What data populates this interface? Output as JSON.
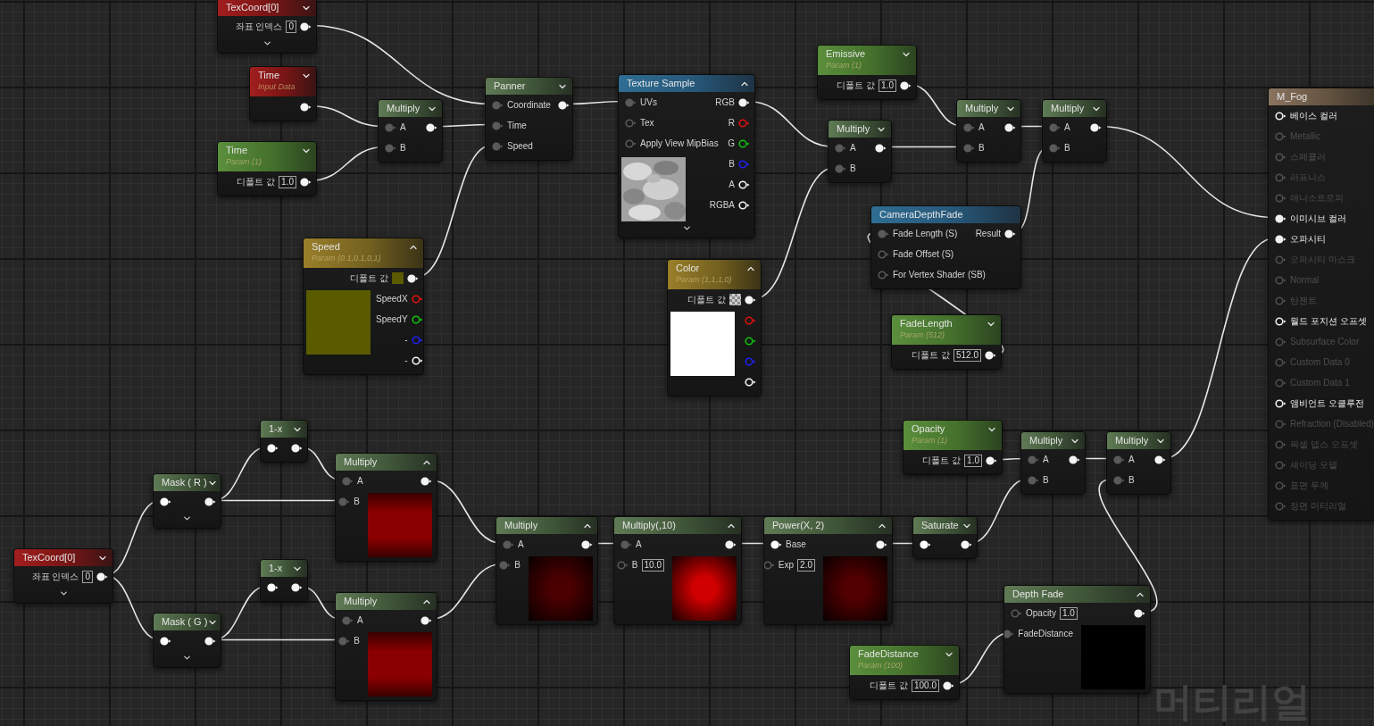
{
  "nodes": [
    {
      "title": "TexCoord[0]",
      "kind": "input",
      "expanded": false,
      "expander": true,
      "rows": [
        {
          "label": "좌표 인덱스",
          "value": "0",
          "out": {
            "connected": true
          }
        }
      ]
    },
    {
      "title": "Time",
      "subtitle": "Input Data",
      "kind": "input",
      "expanded": false,
      "rows": [
        {
          "out": {
            "connected": true
          }
        }
      ]
    },
    {
      "title": "Time",
      "subtitle": "Param (1)",
      "kind": "param",
      "expanded": false,
      "rows": [
        {
          "label": "디폴트 값",
          "value": "1.0",
          "out": {
            "connected": true
          }
        }
      ]
    },
    {
      "title": "Multiply",
      "kind": "math",
      "expanded": false,
      "rows": [
        {
          "in": {
            "connected": true
          },
          "label": "A",
          "out": {
            "connected": true
          }
        },
        {
          "in": {
            "connected": true
          },
          "label": "B"
        }
      ]
    },
    {
      "title": "Panner",
      "kind": "math",
      "expanded": false,
      "rows": [
        {
          "in": {
            "connected": true
          },
          "label": "Coordinate",
          "out": {
            "connected": true
          }
        },
        {
          "in": {
            "connected": true
          },
          "label": "Time"
        },
        {
          "in": {
            "connected": true
          },
          "label": "Speed"
        }
      ]
    },
    {
      "title": "Texture Sample",
      "kind": "texture",
      "expanded": true,
      "expander": true,
      "rows": [
        {
          "in": {
            "connected": true
          },
          "label": "UVs",
          "out_label": "RGB",
          "out": {
            "connected": true
          }
        },
        {
          "in": {
            "connected": false
          },
          "label": "Tex",
          "out_label": "R",
          "out": {
            "connected": false,
            "color": "#e01010"
          }
        },
        {
          "in": {
            "connected": false
          },
          "label": "Apply View MipBias",
          "out_label": "G",
          "out": {
            "connected": false,
            "color": "#10c010"
          }
        }
      ],
      "preview": {
        "kind": "texture"
      },
      "side_rows": [
        {
          "out_label": "B",
          "out": {
            "connected": false,
            "color": "#2020f0"
          }
        },
        {
          "out_label": "A",
          "out": {
            "connected": false
          }
        },
        {
          "out_label": "RGBA",
          "out": {
            "connected": false
          }
        }
      ]
    },
    {
      "title": "Emissive",
      "subtitle": "Param (1)",
      "kind": "param",
      "expanded": false,
      "rows": [
        {
          "label": "디폴트 값",
          "value": "1.0",
          "out": {
            "connected": true
          }
        }
      ]
    },
    {
      "title": "Multiply",
      "kind": "math",
      "expanded": false,
      "rows": [
        {
          "in": {
            "connected": true
          },
          "label": "A",
          "out": {
            "connected": true
          }
        },
        {
          "in": {
            "connected": true
          },
          "label": "B"
        }
      ]
    },
    {
      "title": "Multiply",
      "kind": "math",
      "expanded": false,
      "rows": [
        {
          "in": {
            "connected": true
          },
          "label": "A",
          "out": {
            "connected": true
          }
        },
        {
          "in": {
            "connected": true
          },
          "label": "B"
        }
      ]
    },
    {
      "title": "Multiply",
      "kind": "math",
      "expanded": false,
      "rows": [
        {
          "in": {
            "connected": true
          },
          "label": "A",
          "out": {
            "connected": true
          }
        },
        {
          "in": {
            "connected": true
          },
          "label": "B"
        }
      ]
    },
    {
      "title": "Speed",
      "subtitle": "Param (0.1,0.1,0,1)",
      "kind": "vector",
      "expanded": true,
      "rows": [
        {
          "label": "디폴트 값",
          "swatch": {
            "kind": "solid",
            "color": "#5a5a00"
          },
          "out": {
            "connected": true
          }
        }
      ],
      "preview": {
        "kind": "solid",
        "color": "#5a5a00"
      },
      "side_rows": [
        {
          "out_label": "SpeedX",
          "out": {
            "connected": false,
            "color": "#e01010"
          }
        },
        {
          "out_label": "SpeedY",
          "out": {
            "connected": false,
            "color": "#10c010"
          }
        },
        {
          "out_label": "-",
          "out": {
            "connected": false,
            "color": "#2020f0"
          }
        },
        {
          "out_label": "-",
          "out": {
            "connected": false
          }
        }
      ]
    },
    {
      "title": "Color",
      "subtitle": "Param (1,1,1,0)",
      "kind": "vector",
      "expanded": true,
      "rows": [
        {
          "label": "디폴트 값",
          "swatch": {
            "kind": "checker"
          },
          "out": {
            "connected": true
          }
        }
      ],
      "preview": {
        "kind": "solid",
        "color": "#ffffff"
      },
      "side_rows": [
        {
          "out": {
            "connected": false,
            "color": "#e01010"
          }
        },
        {
          "out": {
            "connected": false,
            "color": "#10c010"
          }
        },
        {
          "out": {
            "connected": false,
            "color": "#2020f0"
          }
        },
        {
          "out": {
            "connected": false
          }
        }
      ]
    },
    {
      "title": "CameraDepthFade",
      "kind": "texture",
      "rows": [
        {
          "in": {
            "connected": true
          },
          "label": "Fade Length (S)",
          "out_label": "Result",
          "out": {
            "connected": true
          }
        },
        {
          "in": {
            "connected": false
          },
          "label": "Fade Offset (S)"
        },
        {
          "in": {
            "connected": false
          },
          "label": "For Vertex Shader (SB)"
        }
      ]
    },
    {
      "title": "FadeLength",
      "subtitle": "Param (512)",
      "kind": "param",
      "expanded": false,
      "rows": [
        {
          "label": "디폴트 값",
          "value": "512.0",
          "out": {
            "connected": true
          }
        }
      ]
    },
    {
      "title": "1-x",
      "kind": "math",
      "expanded": false,
      "rows": [
        {
          "in": {
            "connected": true,
            "color": "#ffffff"
          },
          "out": {
            "connected": true
          }
        }
      ]
    },
    {
      "title": "Mask ( R )",
      "kind": "math",
      "expanded": false,
      "expander": true,
      "rows": [
        {
          "in": {
            "connected": true,
            "color": "#ffffff"
          },
          "out": {
            "connected": true
          }
        }
      ]
    },
    {
      "title": "Multiply",
      "kind": "math",
      "expanded": true,
      "rows": [
        {
          "in": {
            "connected": true
          },
          "label": "A",
          "out": {
            "connected": true
          }
        }
      ],
      "preview": {
        "kind": "linear",
        "color": "#8a0000"
      },
      "side_rows": [
        {
          "in": {
            "connected": true
          },
          "label": "B"
        }
      ]
    },
    {
      "title": "Opacity",
      "subtitle": "Param (1)",
      "kind": "param",
      "expanded": false,
      "rows": [
        {
          "label": "디폴트 값",
          "value": "1.0",
          "out": {
            "connected": true
          }
        }
      ]
    },
    {
      "title": "Multiply",
      "kind": "math",
      "expanded": false,
      "rows": [
        {
          "in": {
            "connected": true
          },
          "label": "A",
          "out": {
            "connected": true
          }
        },
        {
          "in": {
            "connected": true
          },
          "label": "B"
        }
      ]
    },
    {
      "title": "Multiply",
      "kind": "math",
      "expanded": false,
      "rows": [
        {
          "in": {
            "connected": true
          },
          "label": "A",
          "out": {
            "connected": true
          }
        },
        {
          "in": {
            "connected": true
          },
          "label": "B"
        }
      ]
    },
    {
      "title": "M_Fog",
      "kind": "result",
      "rows": [
        {
          "in": {
            "connected": false
          },
          "label": "베이스 컬러",
          "disabled": false
        },
        {
          "in": {
            "connected": false
          },
          "label": "Metallic",
          "disabled": true
        },
        {
          "in": {
            "connected": false
          },
          "label": "스페큘러",
          "disabled": true
        },
        {
          "in": {
            "connected": false
          },
          "label": "러프니스",
          "disabled": true
        },
        {
          "in": {
            "connected": false
          },
          "label": "애니소트로피",
          "disabled": true
        },
        {
          "in": {
            "connected": true
          },
          "label": "이미시브 컬러",
          "disabled": false
        },
        {
          "in": {
            "connected": true
          },
          "label": "오파시티",
          "disabled": false
        },
        {
          "in": {
            "connected": false
          },
          "label": "오파시티 마스크",
          "disabled": true
        },
        {
          "in": {
            "connected": false
          },
          "label": "Normal",
          "disabled": true
        },
        {
          "in": {
            "connected": false
          },
          "label": "탄젠트",
          "disabled": true
        },
        {
          "in": {
            "connected": false
          },
          "label": "월드 포지션 오프셋",
          "disabled": false
        },
        {
          "in": {
            "connected": false
          },
          "label": "Subsurface Color",
          "disabled": true
        },
        {
          "in": {
            "connected": false
          },
          "label": "Custom Data 0",
          "disabled": true
        },
        {
          "in": {
            "connected": false
          },
          "label": "Custom Data 1",
          "disabled": true
        },
        {
          "in": {
            "connected": false
          },
          "label": "앰비언트 오클루전",
          "disabled": false
        },
        {
          "in": {
            "connected": false
          },
          "label": "Refraction (Disabled)",
          "disabled": true
        },
        {
          "in": {
            "connected": false
          },
          "label": "픽셀 뎁스 오프셋",
          "disabled": true
        },
        {
          "in": {
            "connected": false
          },
          "label": "셰이딩 모델",
          "disabled": true
        },
        {
          "in": {
            "connected": false
          },
          "label": "표면 두께",
          "disabled": true
        },
        {
          "in": {
            "connected": false
          },
          "label": "정면 머티리얼",
          "disabled": true
        }
      ]
    },
    {
      "title": "TexCoord[0]",
      "kind": "input",
      "expanded": false,
      "expander": true,
      "rows": [
        {
          "label": "좌표 인덱스",
          "value": "0",
          "out": {
            "connected": true
          }
        }
      ]
    },
    {
      "title": "1-x",
      "kind": "math",
      "expanded": false,
      "rows": [
        {
          "in": {
            "connected": true,
            "color": "#ffffff"
          },
          "out": {
            "connected": true
          }
        }
      ]
    },
    {
      "title": "Mask ( G )",
      "kind": "math",
      "expanded": false,
      "expander": true,
      "rows": [
        {
          "in": {
            "connected": true,
            "color": "#ffffff"
          },
          "out": {
            "connected": true
          }
        }
      ]
    },
    {
      "title": "Multiply",
      "kind": "math",
      "expanded": true,
      "rows": [
        {
          "in": {
            "connected": true
          },
          "label": "A",
          "out": {
            "connected": true
          }
        }
      ],
      "preview": {
        "kind": "linear",
        "color": "#8a0000"
      },
      "side_rows": [
        {
          "in": {
            "connected": true
          },
          "label": "B"
        }
      ]
    },
    {
      "title": "Multiply",
      "kind": "math",
      "expanded": true,
      "rows": [
        {
          "in": {
            "connected": true
          },
          "label": "A",
          "out": {
            "connected": true
          }
        }
      ],
      "preview": {
        "kind": "radial",
        "color": "#4a0000"
      },
      "side_rows": [
        {
          "in": {
            "connected": true
          },
          "label": "B"
        }
      ]
    },
    {
      "title": "Multiply(,10)",
      "kind": "math",
      "expanded": true,
      "rows": [
        {
          "in": {
            "connected": true
          },
          "label": "A",
          "out": {
            "connected": true
          }
        }
      ],
      "preview": {
        "kind": "radial",
        "color": "#d00000"
      },
      "side_rows": [
        {
          "in": {
            "connected": false
          },
          "label": "B",
          "value": "10.0"
        }
      ]
    },
    {
      "title": "Power(X, 2)",
      "kind": "math",
      "expanded": true,
      "rows": [
        {
          "in": {
            "connected": true,
            "color": "#ffffff"
          },
          "label": "Base",
          "out": {
            "connected": true
          }
        }
      ],
      "preview": {
        "kind": "radial",
        "color": "#520000"
      },
      "side_rows": [
        {
          "in": {
            "connected": false
          },
          "label": "Exp",
          "value": "2.0"
        }
      ]
    },
    {
      "title": "Saturate",
      "kind": "math",
      "expanded": false,
      "rows": [
        {
          "in": {
            "connected": true,
            "color": "#ffffff"
          },
          "out": {
            "connected": true
          }
        }
      ]
    },
    {
      "title": "FadeDistance",
      "subtitle": "Param (100)",
      "kind": "param",
      "expanded": false,
      "rows": [
        {
          "label": "디폴트 값",
          "value": "100.0",
          "out": {
            "connected": true
          }
        }
      ]
    },
    {
      "title": "Depth Fade",
      "kind": "math",
      "expanded": true,
      "rows": [
        {
          "in": {
            "connected": false
          },
          "label": "Opacity",
          "value": "1.0",
          "out": {
            "connected": true
          }
        }
      ],
      "preview": {
        "kind": "solid",
        "color": "#000000"
      },
      "side_rows": [
        {
          "in": {
            "connected": true
          },
          "label": "FadeDistance"
        }
      ]
    }
  ],
  "graph_label": "머티리얼"
}
